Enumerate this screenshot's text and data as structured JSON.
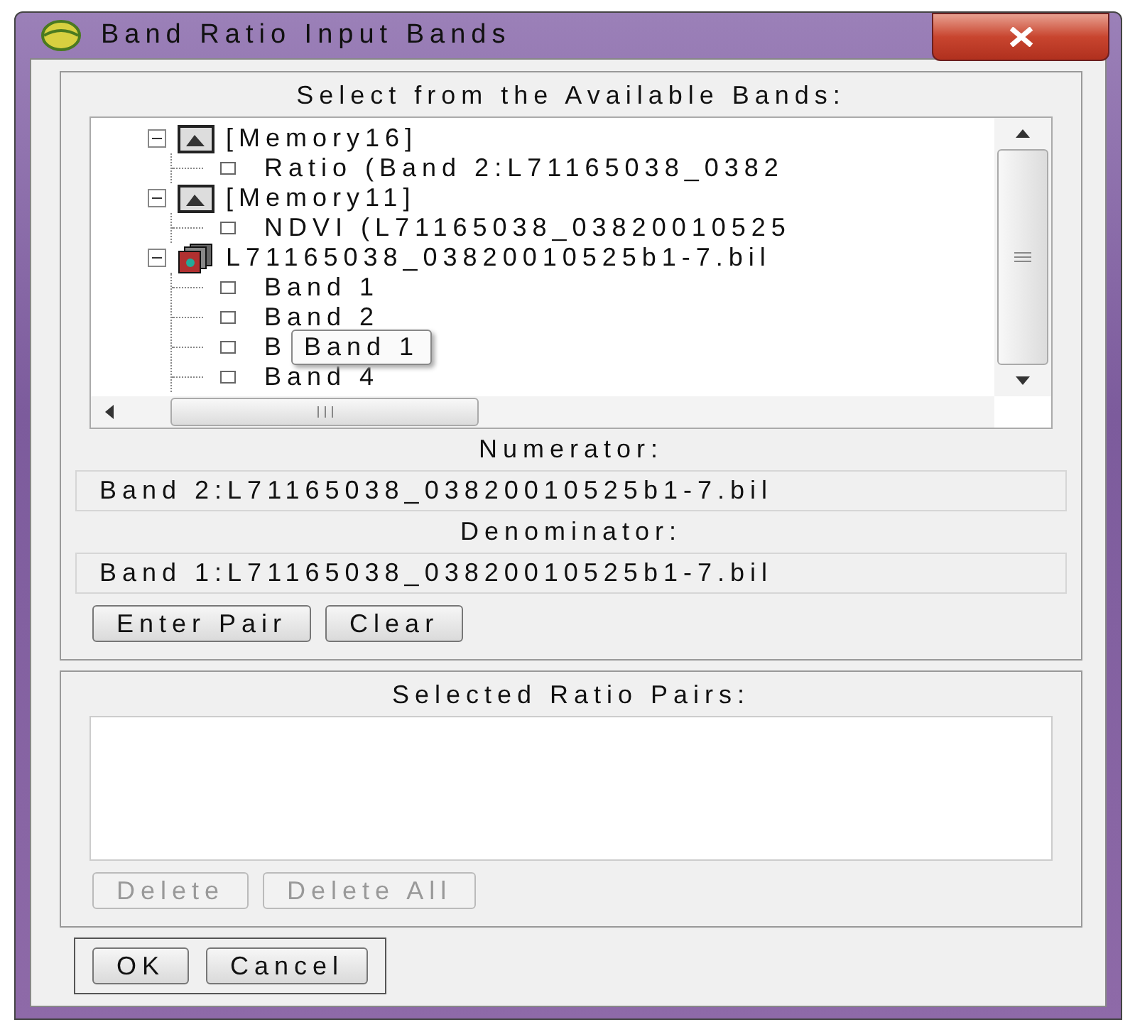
{
  "window": {
    "title": "Band Ratio Input Bands"
  },
  "available": {
    "label": "Select from the Available Bands:",
    "tree": [
      {
        "label": "[Memory16]",
        "kind": "memory",
        "expanded": true,
        "children": [
          {
            "label": "Ratio (Band 2:L71165038_0382",
            "checked": false
          }
        ]
      },
      {
        "label": "[Memory11]",
        "kind": "memory",
        "expanded": true,
        "children": [
          {
            "label": "NDVI (L71165038_03820010525",
            "checked": false
          }
        ]
      },
      {
        "label": "L71165038_03820010525b1-7.bil",
        "kind": "raster",
        "expanded": true,
        "children": [
          {
            "label": "Band 1",
            "checked": false
          },
          {
            "label": "Band 2",
            "checked": false
          },
          {
            "label": "B",
            "checked": false,
            "tooltip": "Band 1"
          },
          {
            "label": "Band 4",
            "checked": false
          }
        ]
      }
    ]
  },
  "numerator": {
    "label": "Numerator:",
    "value": "Band 2:L71165038_03820010525b1-7.bil"
  },
  "denominator": {
    "label": "Denominator:",
    "value": "Band 1:L71165038_03820010525b1-7.bil"
  },
  "pair_buttons": [
    {
      "label": "Enter Pair",
      "disabled": false
    },
    {
      "label": "Clear",
      "disabled": false
    }
  ],
  "selected_pairs": {
    "label": "Selected Ratio Pairs:"
  },
  "pair_list_buttons": [
    {
      "label": "Delete",
      "disabled": true
    },
    {
      "label": "Delete All",
      "disabled": true
    }
  ],
  "dialog_buttons": [
    {
      "label": "OK",
      "disabled": false
    },
    {
      "label": "Cancel",
      "disabled": false
    }
  ]
}
